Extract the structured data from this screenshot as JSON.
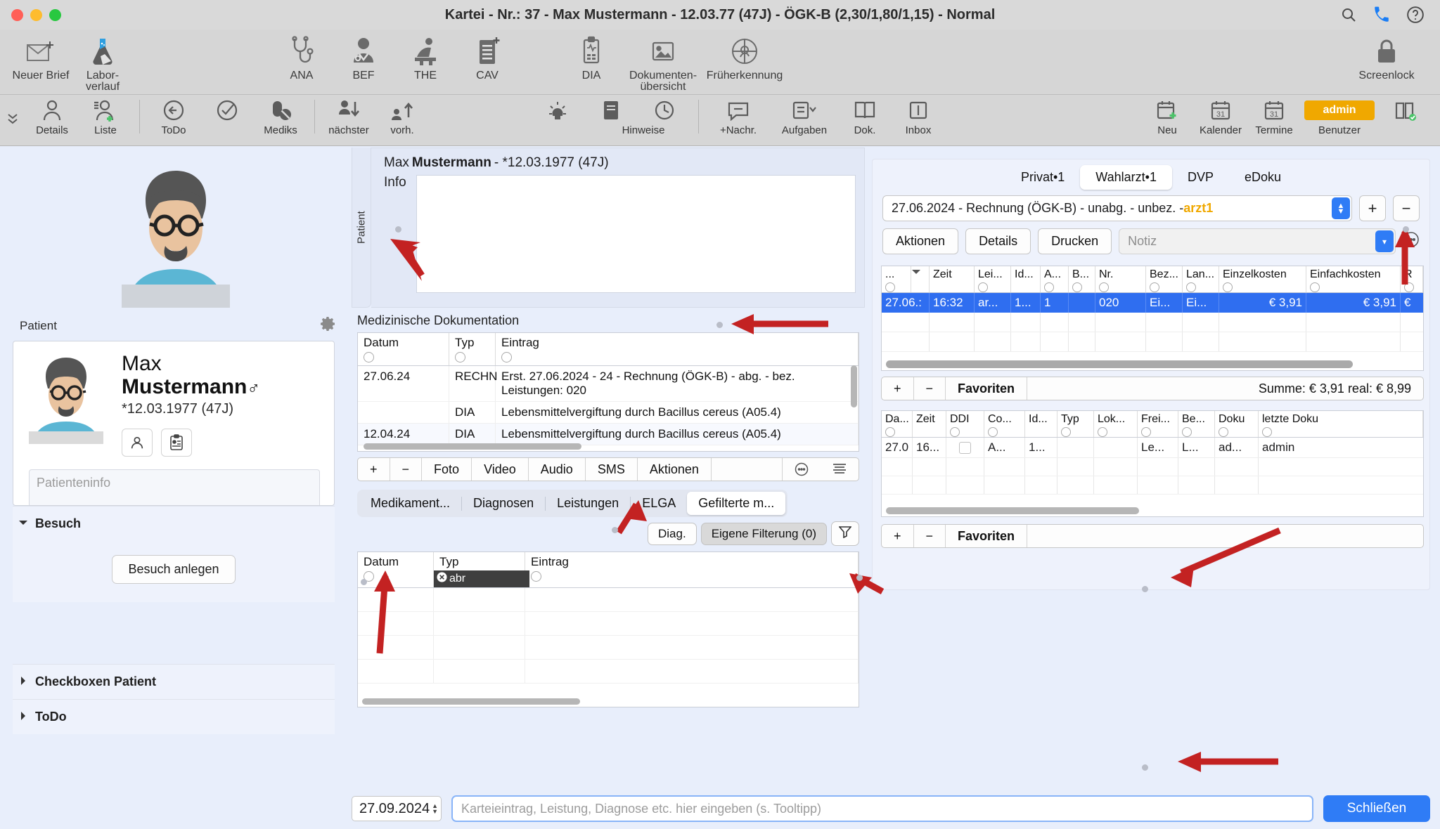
{
  "window": {
    "title": "Kartei - Nr.: 37 - Max Mustermann - 12.03.77 (47J) - ÖGK-B (2,30/1,80/1,15) - Normal"
  },
  "toolbar_main": {
    "items": [
      {
        "label": "Neuer Brief",
        "icon": "new-letter-icon"
      },
      {
        "label": "Labor-\nverlauf",
        "icon": "lab-flask-icon"
      },
      {
        "label": "ANA",
        "icon": "stethoscope-icon"
      },
      {
        "label": "BEF",
        "icon": "doctor-icon"
      },
      {
        "label": "THE",
        "icon": "therapy-icon"
      },
      {
        "label": "CAV",
        "icon": "clipboard-plus-icon"
      },
      {
        "label": "DIA",
        "icon": "diagnosis-icon"
      },
      {
        "label": "Dokumenten-\nübersicht",
        "icon": "image-icon"
      },
      {
        "label": "Früherkennung",
        "icon": "screening-icon"
      },
      {
        "label": "Screenlock",
        "icon": "lock-icon"
      }
    ]
  },
  "toolbar_secondary": {
    "items": [
      {
        "label": "Details",
        "icon": "person-icon"
      },
      {
        "label": "Liste",
        "icon": "person-add-icon"
      },
      {
        "label": "ToDo",
        "icon": "back-arrow-icon"
      },
      {
        "label": "",
        "icon": "check-circle-icon"
      },
      {
        "label": "Mediks",
        "icon": "pill-icon"
      },
      {
        "label": "nächster",
        "icon": "next-patient-icon"
      },
      {
        "label": "vorh.",
        "icon": "previous-patient-icon"
      },
      {
        "label": "Hinweise",
        "icon": "lamp-icon"
      },
      {
        "label": "",
        "icon": "note-icon"
      },
      {
        "label": "",
        "icon": "clock-icon"
      },
      {
        "label": "+Nachr.",
        "icon": "message-icon"
      },
      {
        "label": "Aufgaben",
        "icon": "tasks-icon"
      },
      {
        "label": "Dok.",
        "icon": "book-icon"
      },
      {
        "label": "Inbox",
        "icon": "inbox-icon"
      },
      {
        "label": "Neu",
        "icon": "calendar-new-icon"
      },
      {
        "label": "Kalender",
        "icon": "calendar-icon"
      },
      {
        "label": "Termine",
        "icon": "appointments-icon"
      },
      {
        "label": "Benutzer",
        "icon": "user-icon"
      }
    ],
    "user_badge": "admin"
  },
  "patient_panel": {
    "section_label": "Patient",
    "first_name": "Max",
    "last_name": "Mustermann",
    "gender_symbol": "♂",
    "dob": "*12.03.1977 (47J)",
    "info_placeholder": "Patienteninfo",
    "accordions": [
      {
        "label": "Besuch",
        "expanded": true,
        "button": "Besuch anlegen"
      },
      {
        "label": "Checkboxen Patient",
        "expanded": false
      },
      {
        "label": "ToDo",
        "expanded": false
      }
    ]
  },
  "patient_header": {
    "vertical_tab": "Patient",
    "name_prefix": "Max ",
    "name_bold": "Mustermann",
    "name_suffix": " - *12.03.1977 (47J)",
    "info_label": "Info"
  },
  "medical_doc": {
    "title": "Medizinische Dokumentation",
    "columns": [
      "Datum",
      "Typ",
      "Eintrag"
    ],
    "rows": [
      {
        "datum": "27.06.24",
        "typ": "RECHN",
        "eintrag": "Erst. 27.06.2024 - 24 - Rechnung (ÖGK-B) - abg. - bez.",
        "eintrag2": "Leistungen: 020"
      },
      {
        "datum": "",
        "typ": "DIA",
        "eintrag": "Lebensmittelvergiftung durch Bacillus cereus (A05.4)"
      },
      {
        "datum": "12.04.24",
        "typ": "DIA",
        "eintrag": "Lebensmittelvergiftung durch Bacillus cereus (A05.4)"
      }
    ],
    "action_bar": [
      "+",
      "−",
      "Foto",
      "Video",
      "Audio",
      "SMS",
      "Aktionen"
    ],
    "action_icons": [
      "more-circle-icon",
      "list-icon"
    ]
  },
  "filter_tabs": {
    "items": [
      "Medikament...",
      "Diagnosen",
      "Leistungen",
      "ELGA",
      "Gefilterte m..."
    ],
    "active": "Gefilterte m...",
    "pills": [
      {
        "label": "Diag.",
        "style": "white"
      },
      {
        "label": "Eigene Filterung (0)",
        "style": "grey"
      }
    ],
    "filter_icon": "funnel-icon"
  },
  "filtered_table": {
    "columns": [
      "Datum",
      "Typ",
      "Eintrag"
    ],
    "typ_filter_value": "abr",
    "typ_filter_clear_icon": "clear-circle-icon"
  },
  "right_panel": {
    "tabs": [
      {
        "label": "Privat•1",
        "active": false
      },
      {
        "label": "Wahlarzt•1",
        "active": true
      },
      {
        "label": "DVP",
        "active": false
      },
      {
        "label": "eDoku",
        "active": false
      }
    ],
    "combo_value_prefix": "27.06.2024 - Rechnung (ÖGK-B) - unabg. - unbez. - ",
    "combo_value_user": "arzt1",
    "combo_user_color": "#f0a800",
    "add_button": "+",
    "remove_button": "−",
    "buttons": [
      "Aktionen",
      "Details",
      "Drucken"
    ],
    "note_placeholder": "Notiz",
    "more_icon": "more-circle-icon",
    "grid_top": {
      "columns": [
        "...",
        "Zeit",
        "Lei...",
        "Id...",
        "A...",
        "B...",
        "Nr.",
        "Bez...",
        "Lan...",
        "Einzelkosten",
        "Einfachkosten",
        "R"
      ],
      "rows": [
        {
          "cells": [
            "27.06.:",
            "16:32",
            "ar...",
            "1...",
            "1",
            "",
            "020",
            "Ei...",
            "Ei...",
            "€ 3,91",
            "€ 3,91",
            "€"
          ],
          "selected": true
        }
      ]
    },
    "favoriten_label": "Favoriten",
    "summe_label": "Summe: € 3,91 real: € 8,99",
    "grid_bottom": {
      "columns": [
        "Da...",
        "Zeit",
        "DDI",
        "Co...",
        "Id...",
        "Typ",
        "Lok...",
        "Frei...",
        "Be...",
        "Doku",
        "letzte Doku"
      ],
      "rows": [
        {
          "cells": [
            "27.0",
            "16...",
            "",
            "A...",
            "1...",
            "",
            "",
            "Le...",
            "L...",
            "ad...",
            "admin"
          ]
        }
      ]
    },
    "favoriten_label_bottom": "Favoriten"
  },
  "bottom_bar": {
    "date": "27.09.2024",
    "entry_placeholder": "Karteieintrag, Leistung, Diagnose etc. hier eingeben (s. Tooltipp)",
    "close_button": "Schließen"
  }
}
